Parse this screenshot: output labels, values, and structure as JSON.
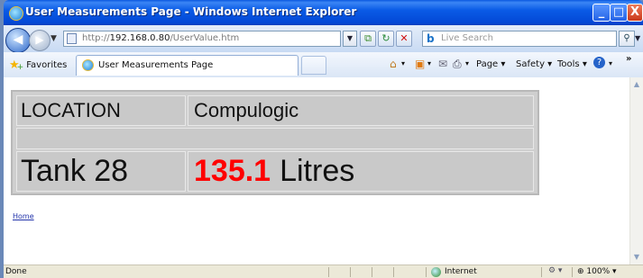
{
  "window": {
    "title": "User Measurements Page - Windows Internet Explorer",
    "minimize_label": "_",
    "maximize_label": "□",
    "close_label": "X"
  },
  "address": {
    "url_prefix": "http://",
    "url_host": "192.168.0.80",
    "url_path": "/UserValue.htm"
  },
  "search": {
    "placeholder": "Live Search"
  },
  "favorites": {
    "label": "Favorites"
  },
  "tab": {
    "title": "User Measurements Page"
  },
  "commands": {
    "page": "Page",
    "safety": "Safety",
    "tools": "Tools"
  },
  "measurements": {
    "location_label": "LOCATION",
    "location_value": "Compulogic",
    "tank_name": "Tank 28",
    "value": "135.1",
    "unit": "Litres"
  },
  "links": {
    "home": "Home"
  },
  "status": {
    "text": "Done",
    "zone": "Internet",
    "zoom": "100%"
  },
  "colors": {
    "value_highlight": "#ff0000",
    "titlebar": "#0a58e0"
  }
}
